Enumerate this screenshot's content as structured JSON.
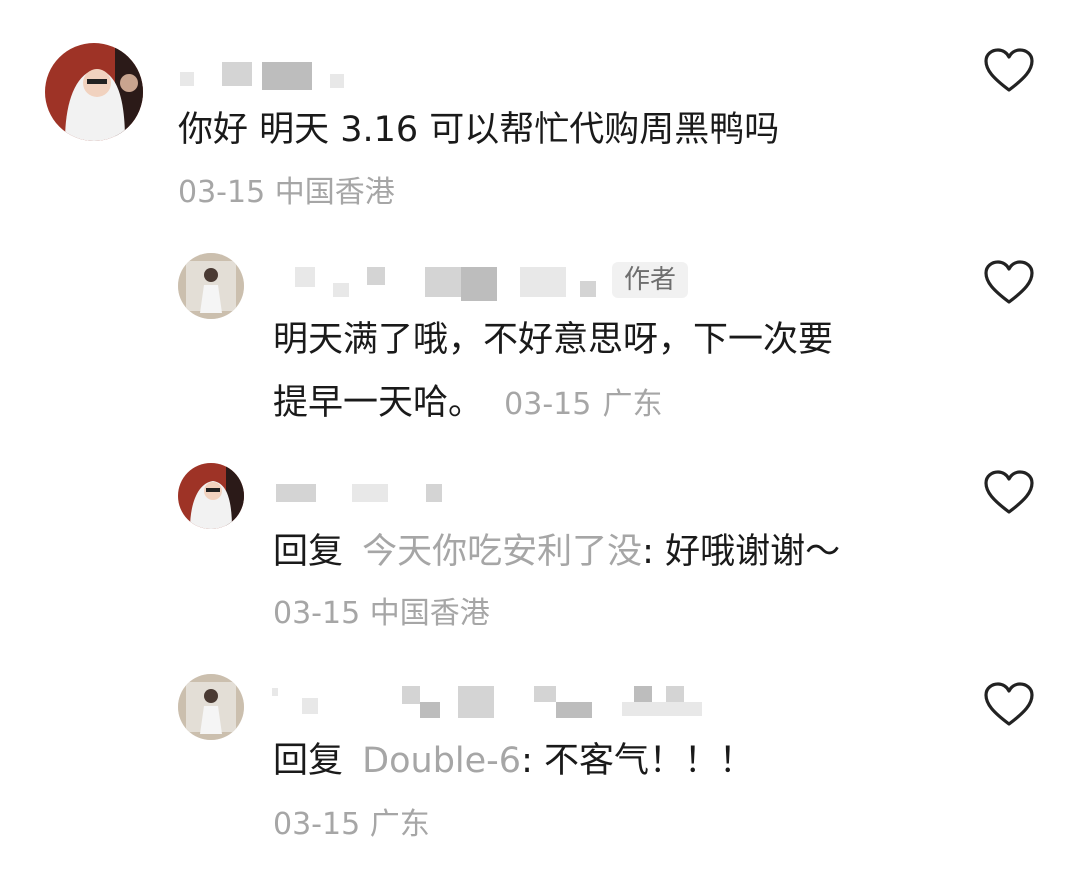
{
  "comments": [
    {
      "text": "你好 明天 3.16 可以帮忙代购周黑鸭吗",
      "time": "03-15",
      "location": "中国香港"
    },
    {
      "author_tag": "作者",
      "text_line1": "明天满了哦，不好意思呀，下一次要",
      "text_line2": "提早一天哈。",
      "time": "03-15",
      "location": "广东"
    },
    {
      "reply_prefix": "回复",
      "reply_target": "今天你吃安利了没",
      "text": ": 好哦谢谢～",
      "time": "03-15",
      "location": "中国香港"
    },
    {
      "reply_prefix": "回复",
      "reply_target": "Double-6",
      "text": ": 不客气！！！",
      "time": "03-15",
      "location": "广东"
    }
  ],
  "icons": {
    "like": "heart-outline-icon"
  },
  "colors": {
    "text": "#1a1a1a",
    "meta": "#a6a6a6",
    "icon": "#222222"
  }
}
